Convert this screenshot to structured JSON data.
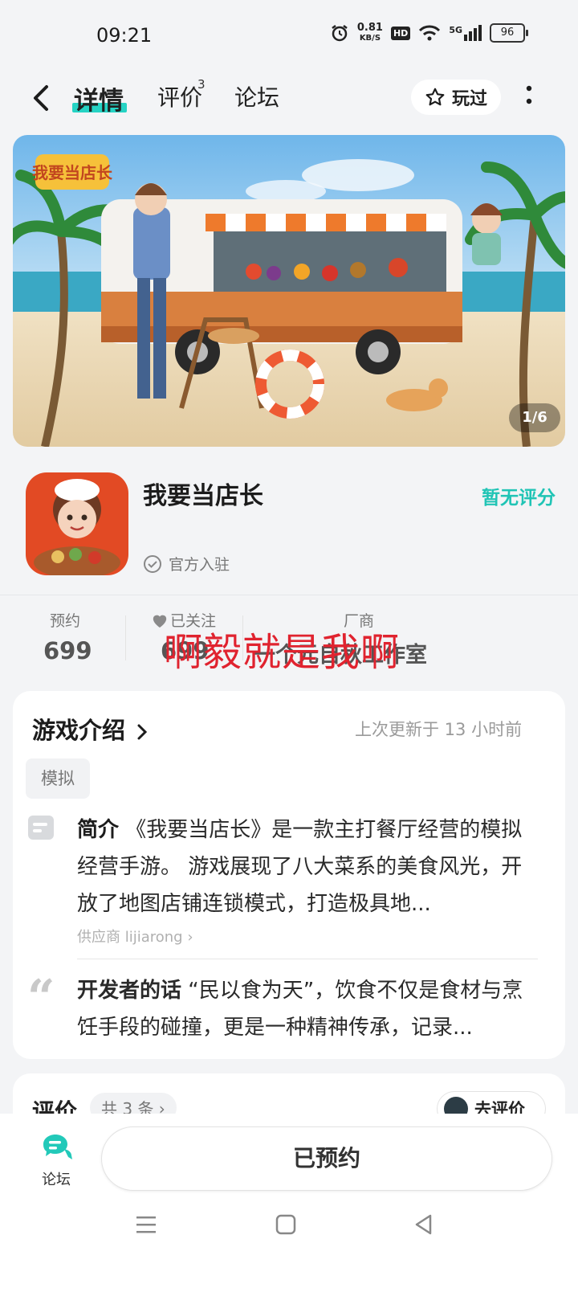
{
  "status": {
    "time": "09:21",
    "speed_top": "0.81",
    "speed_bottom": "KB/S",
    "hd": "HD",
    "network": "5G",
    "battery": "96"
  },
  "nav": {
    "tab_detail": "详情",
    "tab_review": "评价",
    "tab_review_count": "3",
    "tab_forum": "论坛",
    "played_label": "玩过"
  },
  "banner": {
    "counter": "1/6",
    "logo_text": "我要当店长"
  },
  "app": {
    "name": "我要当店长",
    "score_label": "暂无评分",
    "official": "官方入驻"
  },
  "stats": {
    "reserve_label": "预约",
    "reserve_value": "699",
    "follow_label": "已关注",
    "follow_value": "699",
    "vendor_label": "厂商",
    "vendor_value": "一个元自秋工作室",
    "watermark": "啊毅就是我啊"
  },
  "intro": {
    "title": "游戏介绍",
    "updated": "上次更新于 13 小时前",
    "tag": "模拟",
    "summary_label": "简介",
    "summary_text": "《我要当店长》是一款主打餐厅经营的模拟经营手游。 游戏展现了八大菜系的美食风光，开放了地图店铺连锁模式，打造极具地...",
    "supplier": "供应商 lijiarong",
    "dev_label": "开发者的话",
    "dev_text": "“民以食为天”，饮食不仅是食材与烹饪手段的碰撞，更是一种精神传承，记录..."
  },
  "review": {
    "title": "评价",
    "count": "共 3 条",
    "write_label": "去评价"
  },
  "bottom": {
    "forum_label": "论坛",
    "reserved_label": "已预约"
  },
  "colors": {
    "accent": "#26d3c4",
    "score": "#20c4b5",
    "watermark": "#e0232f"
  }
}
